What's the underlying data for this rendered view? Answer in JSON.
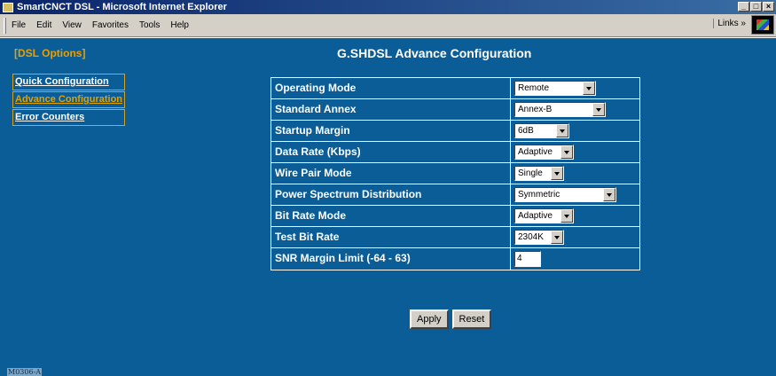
{
  "window": {
    "title": "SmartCNCT DSL - Microsoft Internet Explorer",
    "controls": [
      "_",
      "□",
      "×"
    ]
  },
  "menubar": {
    "items": [
      "File",
      "Edit",
      "View",
      "Favorites",
      "Tools",
      "Help"
    ],
    "links_label": "Links »"
  },
  "sidebar": {
    "title": "[DSL Options]",
    "items": [
      {
        "label": "Quick Configuration"
      },
      {
        "label": "Advance Configuration"
      },
      {
        "label": "Error Counters"
      }
    ],
    "active_item": "Advance Configuration"
  },
  "main": {
    "title": "G.SHDSL Advance Configuration",
    "rows": [
      {
        "label": "Operating Mode",
        "value": "Remote"
      },
      {
        "label": "Standard Annex",
        "value": "Annex-B"
      },
      {
        "label": "Startup Margin",
        "value": "6dB"
      },
      {
        "label": "Data Rate (Kbps)",
        "value": "Adaptive"
      },
      {
        "label": "Wire Pair Mode",
        "value": "Single"
      },
      {
        "label": "Power Spectrum Distribution",
        "value": "Symmetric"
      },
      {
        "label": "Bit Rate Mode",
        "value": "Adaptive"
      },
      {
        "label": "Test Bit Rate",
        "value": "2304K"
      },
      {
        "label": "SNR Margin Limit (-64 - 63)",
        "value": "4"
      }
    ],
    "apply_label": "Apply",
    "reset_label": "Reset"
  },
  "figure_id": "M0306-A",
  "colors": {
    "background": "#0b5d98",
    "accent": "#e8a000",
    "titlebar": "#0a246a"
  }
}
